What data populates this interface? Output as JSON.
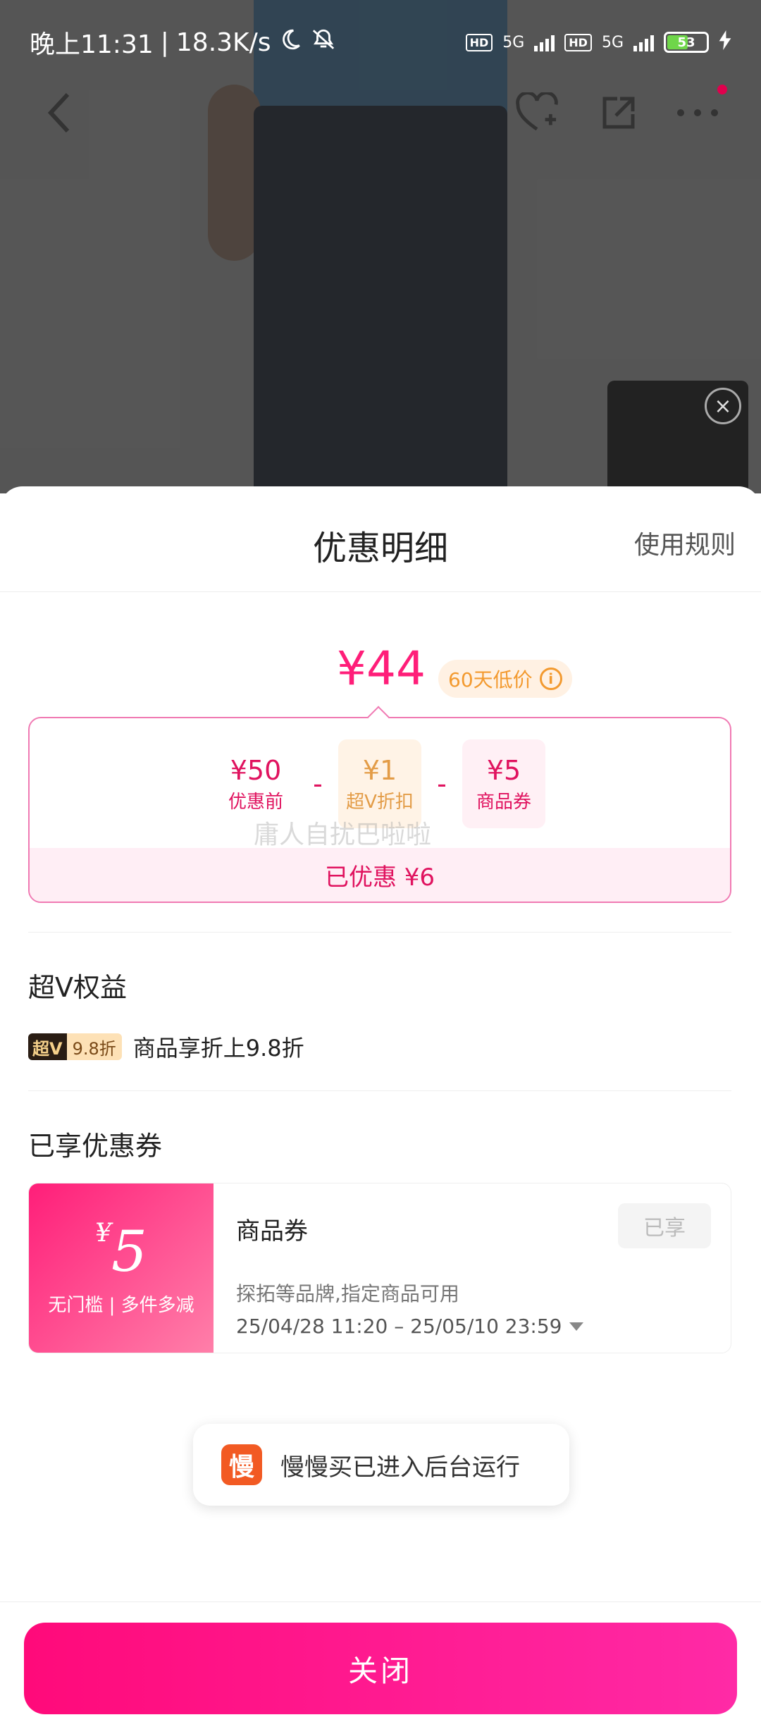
{
  "status_bar": {
    "time": "晚上11:31",
    "speed": "18.3K/s",
    "hd1": "HD",
    "net1": "5G",
    "hd2": "HD",
    "net2": "5G",
    "battery": "53",
    "battery_level": 0.53
  },
  "nav": {
    "icons": [
      "back-arrow-icon",
      "heart-plus-icon",
      "share-icon",
      "more-icon"
    ]
  },
  "sheet": {
    "title": "优惠明细",
    "rules_link": "使用规则",
    "price": "¥44",
    "low_price_badge": "60天低价",
    "calc": {
      "base_value": "¥50",
      "base_label": "优惠前",
      "op1": "-",
      "svip_value": "¥1",
      "svip_label": "超V折扣",
      "op2": "-",
      "coupon_value": "¥5",
      "coupon_label": "商品券",
      "saved": "已优惠 ¥6"
    },
    "watermark": "庸人自扰巴啦啦",
    "svip_section": {
      "title": "超V权益",
      "badge_a": "超V",
      "badge_b": "9.8折",
      "text": "商品享折上9.8折"
    },
    "coupon_section": {
      "title": "已享优惠券",
      "currency": "¥",
      "amount": "5",
      "condition": "无门槛 | 多件多减",
      "name": "商品券",
      "desc": "探拓等品牌,指定商品可用",
      "time": "25/04/28 11:20 – 25/05/10 23:59",
      "status": "已享"
    },
    "toast": {
      "logo": "慢",
      "text": "慢慢买已进入后台运行"
    },
    "close_button": "关闭"
  },
  "colors": {
    "accent": "#ff1e79",
    "svip": "#e39c47",
    "low_price": "#f39a2f"
  }
}
